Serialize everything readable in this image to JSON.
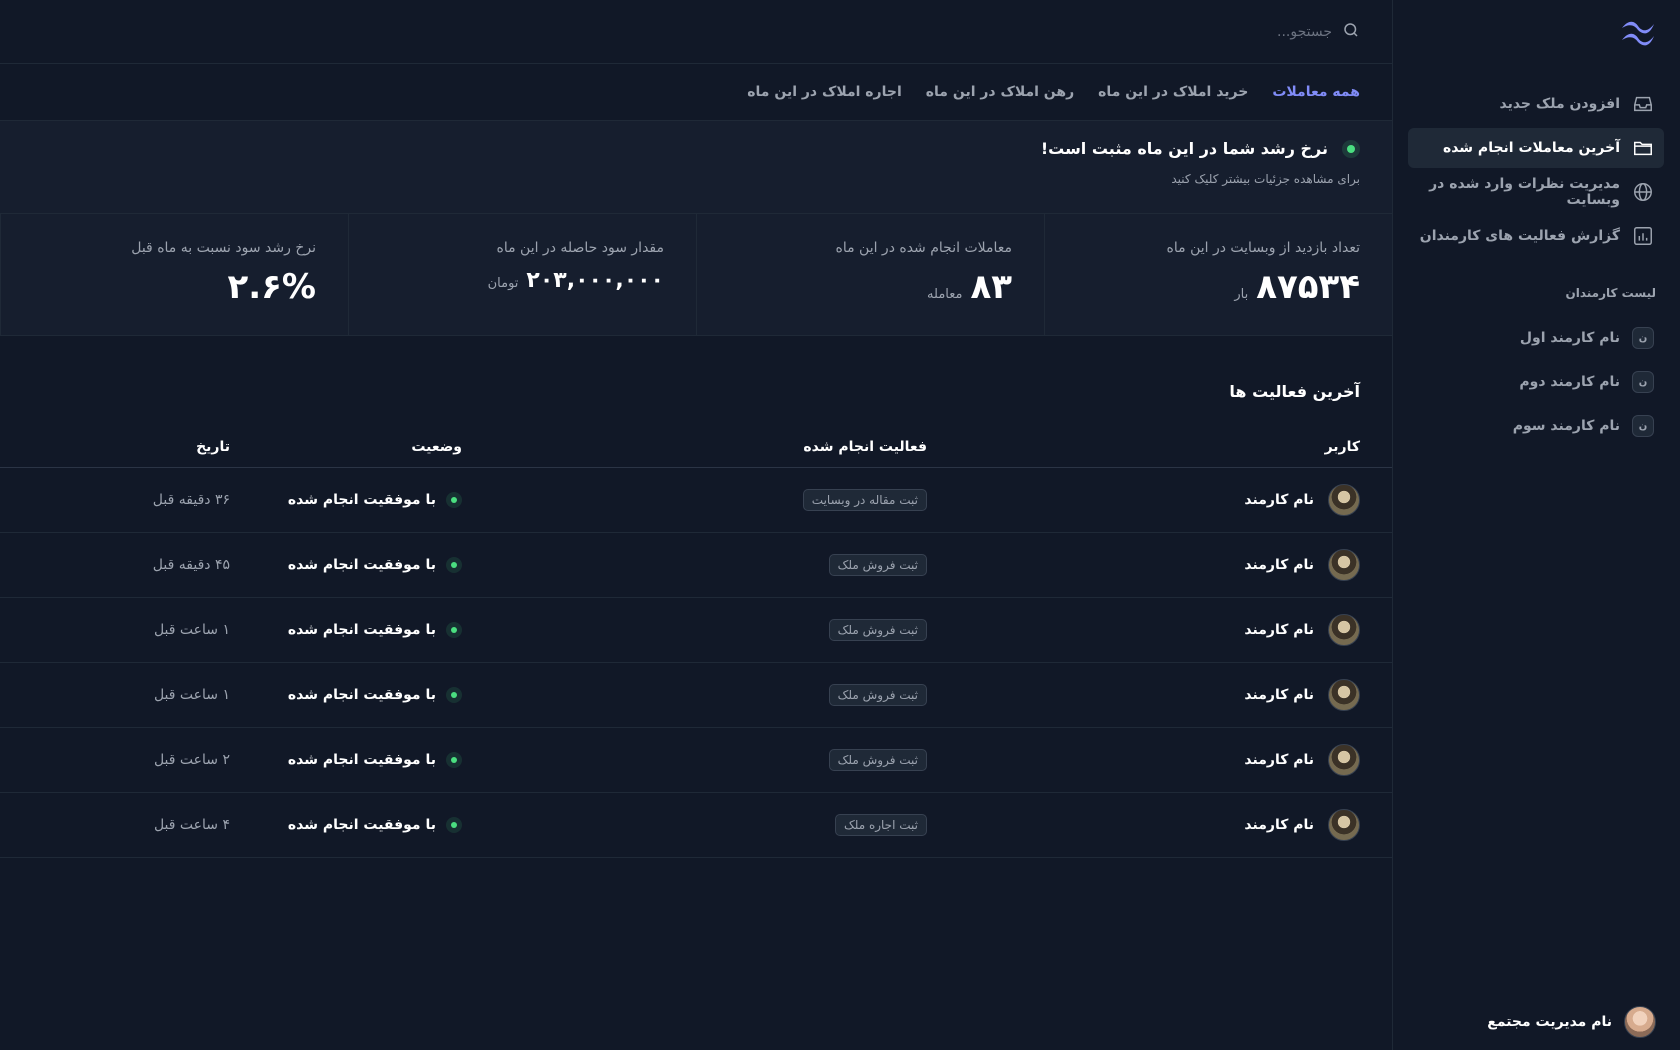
{
  "colors": {
    "accent": "#818cf8",
    "success": "#4ade80",
    "background": "#111827",
    "panel": "#161e2e"
  },
  "sidebar": {
    "logo_icon": "wave-logo-icon",
    "nav": [
      {
        "label": "افزودن ملک جدید",
        "icon": "inbox-icon",
        "active": false
      },
      {
        "label": "آخرین معاملات انجام شده",
        "icon": "folder-icon",
        "active": true
      },
      {
        "label": "مدیریت نظرات وارد شده در وبسایت",
        "icon": "globe-icon",
        "active": false
      },
      {
        "label": "گزارش فعالیت های کارمندان",
        "icon": "chart-bar-icon",
        "active": false
      }
    ],
    "team_title": "لیست کارمندان",
    "team": [
      {
        "initial": "ن",
        "name": "نام کارمند اول"
      },
      {
        "initial": "ن",
        "name": "نام کارمند دوم"
      },
      {
        "initial": "ن",
        "name": "نام کارمند سوم"
      }
    ],
    "profile_name": "نام مدیریت مجتمع"
  },
  "search": {
    "placeholder": "جستجو..."
  },
  "tabs": [
    {
      "label": "همه معاملات",
      "active": true
    },
    {
      "label": "خرید املاک در این ماه",
      "active": false
    },
    {
      "label": "رهن املاک در این ماه",
      "active": false
    },
    {
      "label": "اجاره املاک در این ماه",
      "active": false
    }
  ],
  "growth": {
    "title": "نرخ رشد شما در این ماه مثبت است!",
    "subtitle": "برای مشاهده جزئیات بیشتر کلیک کنید"
  },
  "stats": [
    {
      "label": "تعداد بازدید از وبسایت در این ماه",
      "value": "۸۷۵۳۴",
      "unit": "بار"
    },
    {
      "label": "معاملات انجام شده در این ماه",
      "value": "۸۳",
      "unit": "معامله"
    },
    {
      "label": "مقدار سود حاصله در این ماه",
      "value": "۲۰۳,۰۰۰,۰۰۰",
      "unit": "تومان"
    },
    {
      "label": "نرخ رشد سود نسبت به ماه قبل",
      "value": "۲.۶%",
      "unit": ""
    }
  ],
  "activity": {
    "title": "آخرین فعالیت ها",
    "headers": {
      "user": "کاربر",
      "action": "فعالیت انجام شده",
      "status": "وضعیت",
      "date": "تاریخ"
    },
    "rows": [
      {
        "user": "نام کارمند",
        "action": "ثبت مقاله در وبسایت",
        "status": "با موفقیت انجام شده",
        "date": "۳۶ دقیقه قبل"
      },
      {
        "user": "نام کارمند",
        "action": "ثبت فروش ملک",
        "status": "با موفقیت انجام شده",
        "date": "۴۵ دقیقه قبل"
      },
      {
        "user": "نام کارمند",
        "action": "ثبت فروش ملک",
        "status": "با موفقیت انجام شده",
        "date": "۱ ساعت قبل"
      },
      {
        "user": "نام کارمند",
        "action": "ثبت فروش ملک",
        "status": "با موفقیت انجام شده",
        "date": "۱ ساعت قبل"
      },
      {
        "user": "نام کارمند",
        "action": "ثبت فروش ملک",
        "status": "با موفقیت انجام شده",
        "date": "۲ ساعت قبل"
      },
      {
        "user": "نام کارمند",
        "action": "ثبت اجاره ملک",
        "status": "با موفقیت انجام شده",
        "date": "۴ ساعت قبل"
      }
    ]
  }
}
